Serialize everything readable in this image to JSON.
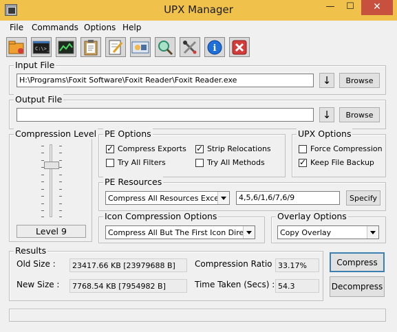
{
  "window": {
    "title": "UPX Manager",
    "minimize_glyph": "—",
    "maximize_glyph": "☐",
    "close_glyph": "✕"
  },
  "menu": {
    "items": [
      "File",
      "Commands",
      "Options",
      "Help"
    ]
  },
  "toolbar": {
    "buttons": [
      {
        "icon": "folder-open-icon",
        "color": "#f0a030"
      },
      {
        "icon": "command-prompt-icon",
        "color": "#1d1d1d",
        "text": "C:\\>_"
      },
      {
        "icon": "chart-icon",
        "color": "#2e7d32"
      },
      {
        "icon": "clipboard-icon",
        "color": "#c8a060"
      },
      {
        "icon": "edit-document-icon",
        "color": "#ffffff"
      },
      {
        "icon": "script-icon",
        "color": "#4a6fa5"
      },
      {
        "icon": "search-icon",
        "color": "#2a8a6a"
      },
      {
        "icon": "tools-icon",
        "color": "#444444"
      },
      {
        "icon": "info-icon",
        "color": "#1e6fd9",
        "text": "i"
      },
      {
        "icon": "close-icon",
        "color": "#d43c3c",
        "text": "✕"
      }
    ]
  },
  "input_file": {
    "label": "Input File",
    "value": "H:\\Programs\\Foxit Software\\Foxit Reader\\Foxit Reader.exe",
    "arrow": "↓",
    "browse_label": "Browse"
  },
  "output_file": {
    "label": "Output File",
    "value": "",
    "arrow": "↓",
    "browse_label": "Browse"
  },
  "compression_level": {
    "label": "Compression Level",
    "level_text": "Level 9",
    "level": 9,
    "max": 10
  },
  "pe_options": {
    "label": "PE Options",
    "compress_exports": {
      "label": "Compress Exports",
      "checked": true
    },
    "strip_relocations": {
      "label": "Strip Relocations",
      "checked": true
    },
    "try_all_filters": {
      "label": "Try All Filters",
      "checked": false
    },
    "try_all_methods": {
      "label": "Try All Methods",
      "checked": false
    }
  },
  "upx_options": {
    "label": "UPX Options",
    "force_compression": {
      "label": "Force Compression",
      "checked": false
    },
    "keep_file_backup": {
      "label": "Keep File Backup",
      "checked": true
    }
  },
  "pe_resources": {
    "label": "PE Resources",
    "mode_value": "Compress All Resources Except",
    "except_value": "4,5,6/1,6/7,6/9",
    "specify_label": "Specify"
  },
  "icon_compression": {
    "label": "Icon Compression Options",
    "value": "Compress All But The First Icon Directory"
  },
  "overlay_options": {
    "label": "Overlay Options",
    "value": "Copy Overlay"
  },
  "results": {
    "label": "Results",
    "old_size_label": "Old Size :",
    "old_size_value": "23417.66 KB [23979688 B]",
    "new_size_label": "New Size :",
    "new_size_value": "7768.54 KB [7954982 B]",
    "ratio_label": "Compression Ratio",
    "ratio_value": "33.17%",
    "time_label": "Time Taken (Secs) :",
    "time_value": "54.3"
  },
  "actions": {
    "compress_label": "Compress",
    "decompress_label": "Decompress"
  },
  "status": {
    "text": ""
  }
}
